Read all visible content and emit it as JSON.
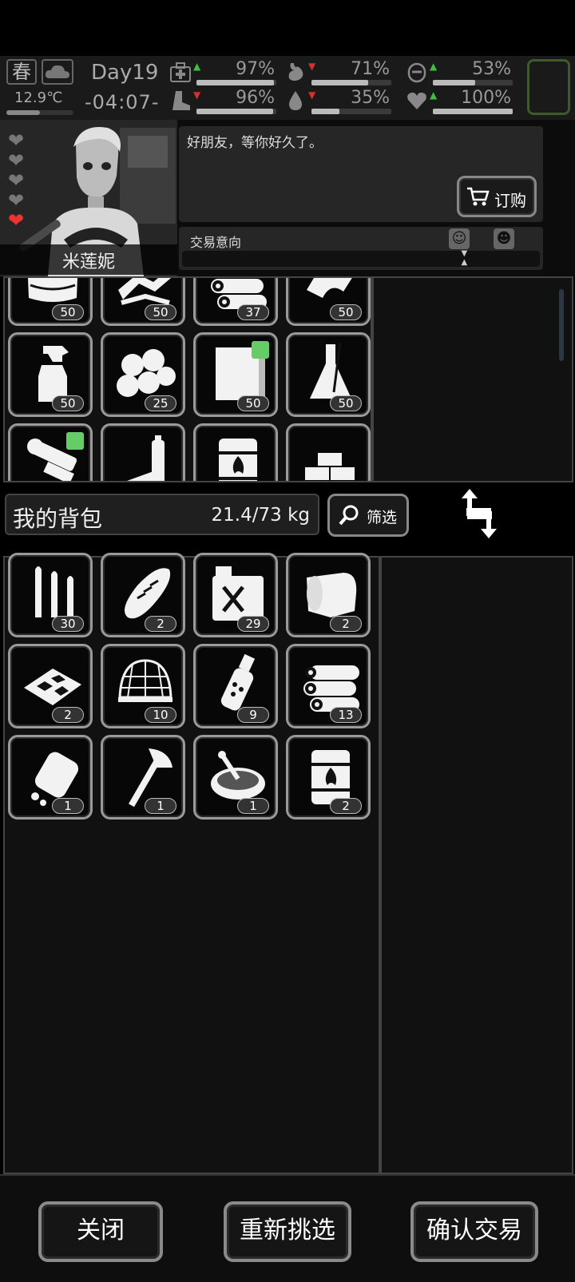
{
  "hud": {
    "season": "春",
    "temperature": "12.9℃",
    "temperature_level": 0.5,
    "day": "Day19",
    "time": "-04:07-",
    "stats": [
      {
        "name": "health",
        "icon": "medkit-icon",
        "trend": "up",
        "value": "97%",
        "level": 0.97
      },
      {
        "name": "hunger",
        "icon": "stomach-icon",
        "trend": "down",
        "value": "71%",
        "level": 0.71
      },
      {
        "name": "mood",
        "icon": "brain-icon",
        "trend": "up",
        "value": "53%",
        "level": 0.53
      },
      {
        "name": "stamina",
        "icon": "boot-icon",
        "trend": "down",
        "value": "96%",
        "level": 0.96
      },
      {
        "name": "thirst",
        "icon": "water-drop-icon",
        "trend": "down",
        "value": "35%",
        "level": 0.35
      },
      {
        "name": "heart",
        "icon": "heart-icon",
        "trend": "up",
        "value": "100%",
        "level": 1.0
      }
    ],
    "colors": {
      "up": "#3fbf3f",
      "down": "#d43030",
      "slot_border": "#3f5a2a"
    }
  },
  "npc": {
    "name": "米莲妮",
    "affection_hearts": 5,
    "affection_active": 1,
    "dialogue": "好朋友，等你好久了。",
    "order_label": "订购",
    "intent_label": "交易意向",
    "intent_level": 0.78
  },
  "merchant_items": [
    {
      "icon": "cloth-icon",
      "qty": "50",
      "note": false
    },
    {
      "icon": "pipe-icon",
      "qty": "50",
      "note": false
    },
    {
      "icon": "logs-icon",
      "qty": "37",
      "note": false
    },
    {
      "icon": "rags-icon",
      "qty": "50",
      "note": false
    },
    {
      "icon": "spray-bottle-icon",
      "qty": "50",
      "note": false
    },
    {
      "icon": "cotton-balls-icon",
      "qty": "25",
      "note": false
    },
    {
      "icon": "paper-icon",
      "qty": "50",
      "note": true
    },
    {
      "icon": "flask-icon",
      "qty": "50",
      "note": false
    },
    {
      "icon": "scope-icon",
      "qty": "",
      "note": true
    },
    {
      "icon": "battery-icon",
      "qty": "",
      "note": false
    },
    {
      "icon": "fire-barrel-icon",
      "qty": "",
      "note": false
    },
    {
      "icon": "bricks-icon",
      "qty": "",
      "note": false
    }
  ],
  "backpack": {
    "title": "我的背包",
    "weight": "21.4/73 kg",
    "filter_label": "筛选",
    "items": [
      {
        "icon": "bullets-icon",
        "qty": "30"
      },
      {
        "icon": "bread-icon",
        "qty": "2"
      },
      {
        "icon": "fuel-can-icon",
        "qty": "29"
      },
      {
        "icon": "cloth-roll-icon",
        "qty": "2"
      },
      {
        "icon": "meat-tray-icon",
        "qty": "2"
      },
      {
        "icon": "net-icon",
        "qty": "10"
      },
      {
        "icon": "grenade-icon",
        "qty": "9"
      },
      {
        "icon": "logs-icon",
        "qty": "13"
      },
      {
        "icon": "pill-bottle-icon",
        "qty": "1"
      },
      {
        "icon": "axe-icon",
        "qty": "1"
      },
      {
        "icon": "soup-bowl-icon",
        "qty": "1"
      },
      {
        "icon": "fire-barrel-icon",
        "qty": "2"
      }
    ]
  },
  "footer": {
    "close": "关闭",
    "reselect": "重新挑选",
    "confirm": "确认交易"
  }
}
